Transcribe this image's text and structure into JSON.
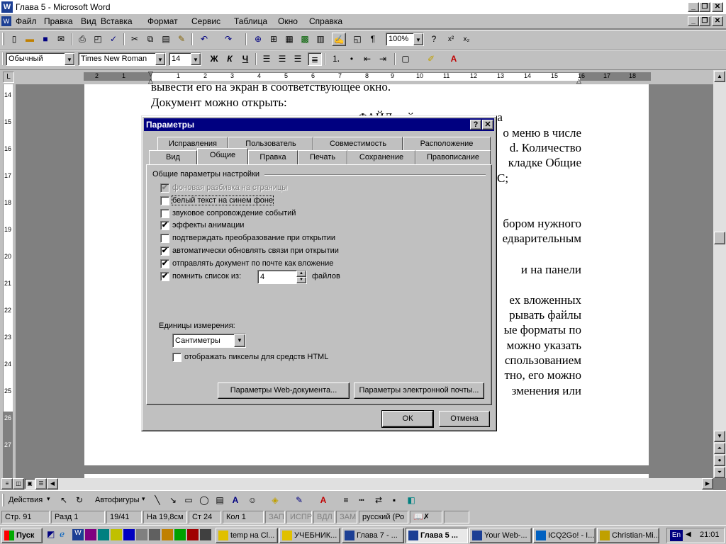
{
  "window": {
    "title": "Глава 5 - Microsoft Word",
    "app_icon": "W",
    "caption_minimize": "_",
    "caption_restore": "❐",
    "caption_close": "✕"
  },
  "menu": [
    "Файл",
    "Правка",
    "Вид",
    "Вставка",
    "Формат",
    "Сервис",
    "Таблица",
    "Окно",
    "Справка"
  ],
  "standard_toolbar": {
    "zoom": "100%",
    "buttons": [
      "new-document",
      "open",
      "save",
      "print",
      "print-preview",
      "spelling",
      "cut",
      "copy",
      "paste",
      "format-painter",
      "undo",
      "redo",
      "hyperlink",
      "tables-borders",
      "insert-table",
      "insert-excel",
      "columns",
      "drawing",
      "document-map",
      "show-formatting",
      "zoom",
      "help"
    ]
  },
  "formatting_toolbar": {
    "style": "Обычный",
    "font": "Times New Roman",
    "size": "14",
    "bold": "Ж",
    "italic": "К",
    "underline": "Ч"
  },
  "ruler": {
    "h_numbers": [
      "2",
      "1",
      "1",
      "2",
      "3",
      "4",
      "5",
      "6",
      "7",
      "8",
      "9",
      "10",
      "11",
      "12",
      "13",
      "14",
      "15",
      "16",
      "17",
      "18"
    ],
    "v_numbers": [
      "14",
      "15",
      "16",
      "17",
      "18",
      "19",
      "20",
      "21",
      "22",
      "23",
      "24",
      "25",
      "26",
      "27"
    ]
  },
  "document": {
    "lines_left": [
      "вывести его на экран в соответствующее окно.",
      "Документ можно открыть:"
    ],
    "lines_right": [
      "ФАЙЛ ... й ... ого   документа",
      "о меню в числе",
      "d.  Количество",
      "кладке  Общие",
      "С;",
      "бором нужного",
      "едварительным",
      "и     на     панели",
      "ех   вложенных",
      "рывать   файлы",
      "ые форматы по",
      "можно   указать",
      "спользованием",
      "тно,  его  можно",
      "зменения     или"
    ]
  },
  "dialog": {
    "title": "Параметры",
    "help_btn": "?",
    "close_btn": "✕",
    "tabs_row1": [
      "Исправления",
      "Пользователь",
      "Совместимость",
      "Расположение"
    ],
    "tabs_row2": [
      "Вид",
      "Общие",
      "Правка",
      "Печать",
      "Сохранение",
      "Правописание"
    ],
    "group_title": "Общие параметры настройки",
    "options": [
      {
        "label": "фоновая разбивка на страницы",
        "checked": "✔",
        "disabled": true
      },
      {
        "label": "белый текст на синем фоне",
        "checked": "",
        "disabled": false
      },
      {
        "label": "звуковое сопровождение событий",
        "checked": "",
        "disabled": false
      },
      {
        "label": "эффекты анимации",
        "checked": "✔",
        "disabled": false
      },
      {
        "label": "подтверждать преобразование при открытии",
        "checked": "",
        "disabled": false
      },
      {
        "label": "автоматически обновлять связи при открытии",
        "checked": "✔",
        "disabled": false
      },
      {
        "label": "отправлять документ по почте как вложение",
        "checked": "✔",
        "disabled": false
      },
      {
        "label": "помнить список из:",
        "checked": "✔",
        "disabled": false
      }
    ],
    "recent_count": "4",
    "recent_suffix": "файлов",
    "units_label": "Единицы измерения:",
    "units_value": "Сантиметры",
    "pixels_html_label": "отображать пикселы для средств HTML",
    "pixels_html_checked": "",
    "web_options_btn": "Параметры Web-документа...",
    "email_options_btn": "Параметры электронной почты...",
    "ok_btn": "ОК",
    "cancel_btn": "Отмена"
  },
  "drawing_toolbar": {
    "actions": "Действия",
    "autoshapes": "Автофигуры"
  },
  "status": {
    "page": "Стр. 91",
    "section": "Разд  1",
    "pages": "19/41",
    "at": "На 19,8см",
    "line": "Ст 24",
    "col": "Кол  1",
    "rec": "ЗАП",
    "trk": "ИСПР",
    "ext": "ВДЛ",
    "ovr": "ЗАМ",
    "lang": "русский (Ро"
  },
  "taskbar": {
    "start": "Пуск",
    "items": [
      "temp на Cl...",
      "УЧЕБНИК...",
      "Глава 7 - ...",
      "Глава 5 ...",
      "Your Web-...",
      "ICQ2Go! - I...",
      "Christian-Mi..."
    ],
    "lang": "En",
    "clock": "21:01"
  }
}
